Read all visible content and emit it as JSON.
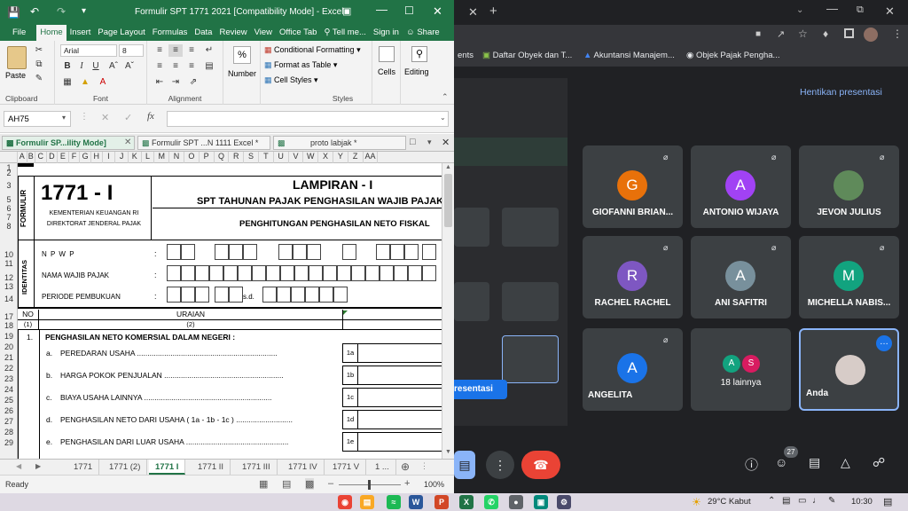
{
  "excel": {
    "title": "Formulir SPT 1771 2021  [Compatibility Mode] - Excel",
    "ribbon_tabs": [
      "File",
      "Home",
      "Insert",
      "Page Layout",
      "Formulas",
      "Data",
      "Review",
      "View",
      "Office Tab",
      "Tell me...",
      "Sign in",
      "Share"
    ],
    "clipboard": {
      "paste": "Paste",
      "label": "Clipboard"
    },
    "font": {
      "name": "Arial",
      "size": "8",
      "label": "Font"
    },
    "alignment": {
      "label": "Alignment"
    },
    "number": {
      "label": "Number"
    },
    "styles": {
      "cond": "Conditional Formatting",
      "table": "Format as Table",
      "cell": "Cell Styles",
      "label": "Styles"
    },
    "cells": {
      "label": "Cells"
    },
    "editing": {
      "label": "Editing"
    },
    "name_box": "AH75",
    "workbook_tabs": [
      "Formulir SP...ility Mode]",
      "Formulir SPT ...N 1111 Excel *",
      "proto labjak *"
    ],
    "columns": [
      "A",
      "B",
      "C",
      "D",
      "E",
      "F",
      "G",
      "H",
      "I",
      "J",
      "K",
      "L",
      "M",
      "N",
      "O",
      "P",
      "Q",
      "R",
      "S",
      "T",
      "U",
      "V",
      "W",
      "X",
      "Y",
      "Z",
      "AA"
    ],
    "rows": [
      "1",
      "2",
      "3",
      "5",
      "6",
      "7",
      "8",
      "10",
      "11",
      "12",
      "13",
      "14",
      "17",
      "18",
      "19",
      "20",
      "21",
      "22",
      "23",
      "24",
      "25",
      "26",
      "27",
      "28",
      "29"
    ],
    "form": {
      "code": "1771 - I",
      "formulir": "FORMULIR",
      "ministry": "KEMENTERIAN KEUANGAN RI",
      "directorate": "DIREKTORAT JENDERAL PAJAK",
      "lampiran": "LAMPIRAN - I",
      "spt": "SPT TAHUNAN PAJAK PENGHASILAN WAJIB PAJAK",
      "section_title": "PENGHITUNGAN PENGHASILAN NETO FISKAL",
      "identitas": "IDENTITAS",
      "npwp": "N P W P",
      "nama": "NAMA WAJIB PAJAK",
      "periode": "PERIODE PEMBUKUAN",
      "sd": "s.d.",
      "colon": ":",
      "no": "NO",
      "uraian": "URAIAN",
      "col1": "(1)",
      "col2": "(2)",
      "item1_no": "1.",
      "item1": "PENGHASILAN NETO KOMERSIAL DALAM NEGERI :",
      "lines": [
        {
          "letter": "a.",
          "text": "PEREDARAN USAHA ...................................................................",
          "code": "1a"
        },
        {
          "letter": "b.",
          "text": "HARGA POKOK PENJUALAN .........................................................",
          "code": "1b"
        },
        {
          "letter": "c.",
          "text": "BIAYA USAHA LAINNYA .............................................................",
          "code": "1c"
        },
        {
          "letter": "d.",
          "text": "PENGHASILAN NETO DARI USAHA ( 1a - 1b - 1c ) ...........................",
          "code": "1d"
        },
        {
          "letter": "e.",
          "text": "PENGHASILAN DARI LUAR USAHA .................................................",
          "code": "1e"
        }
      ]
    },
    "sheet_tabs": [
      "1771",
      "1771 (2)",
      "1771 I",
      "1771 II",
      "1771 III",
      "1771 IV",
      "1771 V",
      "1 ..."
    ],
    "status": "Ready",
    "zoom": "100%"
  },
  "chrome": {
    "bookmarks": [
      "ents",
      "Daftar Obyek dan T...",
      "Akuntansi Manajem...",
      "Objek Pajak Pengha..."
    ],
    "stop_presenting": "Hentikan presentasi",
    "present_button": "resentasi",
    "tiles": [
      {
        "name": "GIOFANNI BRIAN...",
        "initial": "G",
        "color": "#e8710a"
      },
      {
        "name": "ANTONIO WIJAYA",
        "initial": "A",
        "color": "#a142f4"
      },
      {
        "name": "JEVON JULIUS",
        "initial": "",
        "color": "#5f8a5a"
      },
      {
        "name": "RACHEL RACHEL",
        "initial": "R",
        "color": "#7e57c2"
      },
      {
        "name": "ANI SAFITRI",
        "initial": "A",
        "color": "#78909c"
      },
      {
        "name": "MICHELLA NABIS...",
        "initial": "M",
        "color": "#12a37f"
      },
      {
        "name": "ANGELITA",
        "initial": "A",
        "color": "#1a73e8"
      },
      {
        "name": "18 lainnya",
        "initial": "",
        "color": "#3c4043"
      },
      {
        "name": "Anda",
        "initial": "",
        "color": "#3c4043"
      }
    ],
    "others_badges": [
      "A",
      "S"
    ],
    "participants_count": "27"
  },
  "taskbar": {
    "weather": "29°C  Kabut",
    "time": "10:30"
  }
}
